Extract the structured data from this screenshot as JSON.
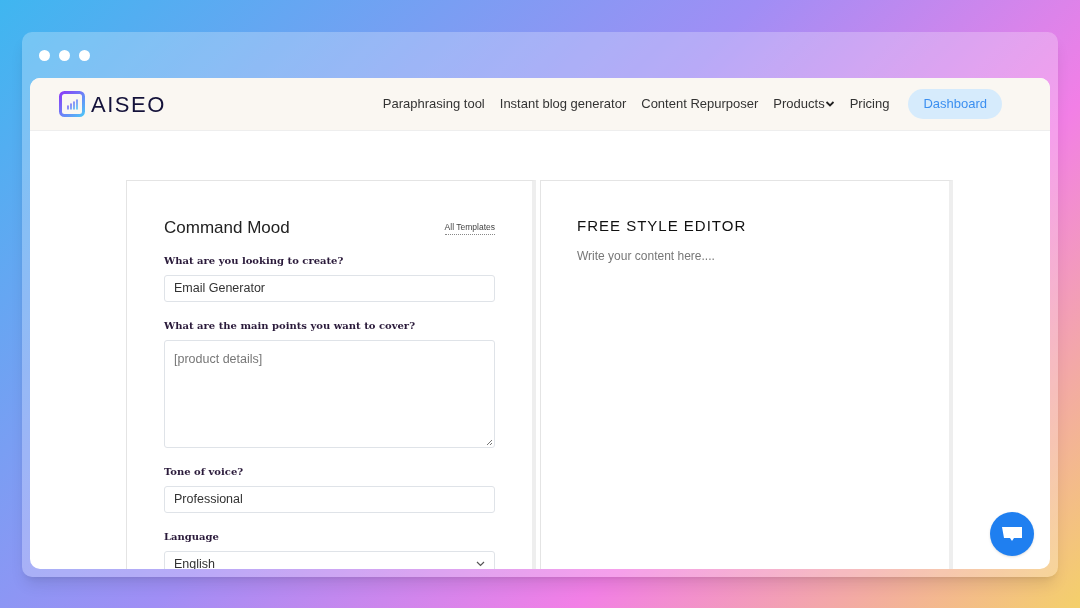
{
  "brand": {
    "name": "AISEO"
  },
  "nav": [
    {
      "label": "Paraphrasing tool",
      "kind": "link"
    },
    {
      "label": "Instant blog generator",
      "kind": "link"
    },
    {
      "label": "Content Repurposer",
      "kind": "link"
    },
    {
      "label": "Products",
      "kind": "dropdown"
    },
    {
      "label": "Pricing",
      "kind": "link"
    },
    {
      "label": "Dashboard",
      "kind": "button"
    }
  ],
  "form": {
    "title": "Command Mood",
    "templates_link": "All Templates",
    "fields": [
      {
        "label": "What are you looking to create?",
        "kind": "input",
        "value": "Email Generator"
      },
      {
        "label": "What are the main points you want to cover?",
        "kind": "textarea",
        "placeholder": "[product details]"
      },
      {
        "label": "Tone of voice?",
        "kind": "input",
        "value": "Professional"
      },
      {
        "label": "Language",
        "kind": "select",
        "value": "English"
      }
    ]
  },
  "editor": {
    "title": "FREE STYLE EDITOR",
    "placeholder": "Write your content here...."
  }
}
